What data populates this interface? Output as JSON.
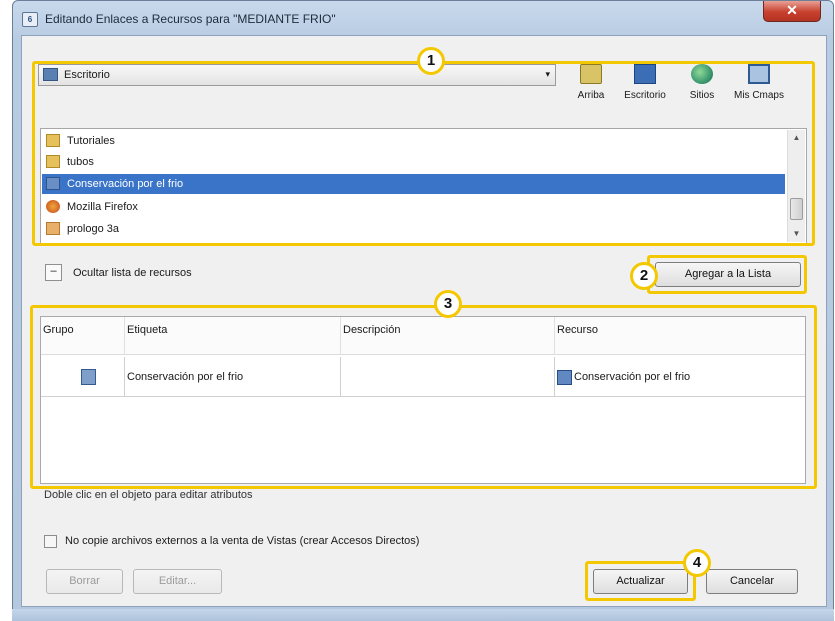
{
  "window": {
    "title": "Editando Enlaces a Recursos para \"MEDIANTE  FRIO\"",
    "close_glyph": "✕"
  },
  "location": {
    "current": "Escritorio",
    "dropdown_glyph": "▾"
  },
  "nav_buttons": [
    {
      "label": "Arriba",
      "icon": "up-folder-icon"
    },
    {
      "label": "Escritorio",
      "icon": "desktop-icon"
    },
    {
      "label": "Sitios",
      "icon": "globe-icon"
    },
    {
      "label": "Mis Cmaps",
      "icon": "my-cmaps-icon"
    }
  ],
  "file_list": {
    "items": [
      {
        "label": "Tutoriales",
        "icon": "folder-icon",
        "selected": false
      },
      {
        "label": "tubos",
        "icon": "folder-icon",
        "selected": false
      },
      {
        "label": "Conservación por el frio",
        "icon": "resource-icon",
        "selected": true
      },
      {
        "label": "Mozilla Firefox",
        "icon": "firefox-icon",
        "selected": false
      },
      {
        "label": "prologo 3a",
        "icon": "shortcut-icon",
        "selected": false
      }
    ]
  },
  "toggle": {
    "glyph": "–",
    "label": "Ocultar lista de recursos"
  },
  "add_button": {
    "label": "Agregar a la Lista"
  },
  "table": {
    "headers": [
      "Grupo",
      "Etiqueta",
      "Descripción",
      "Recurso"
    ],
    "rows": [
      {
        "etiqueta": "Conservación por el frio",
        "descripcion": "",
        "recurso": "Conservación por el frio"
      }
    ]
  },
  "hint": "Doble clic en el objeto para editar atributos",
  "checkbox": {
    "label": "No copie archivos externos a la venta de Vistas (crear Accesos Directos)",
    "checked": false
  },
  "buttons": {
    "borrar": "Borrar",
    "editar": "Editar...",
    "actualizar": "Actualizar",
    "cancelar": "Cancelar"
  },
  "callouts": [
    "1",
    "2",
    "3",
    "4"
  ],
  "colors": {
    "callout": "#f4c800",
    "selection": "#3a74c9",
    "close": "#c8402e"
  }
}
